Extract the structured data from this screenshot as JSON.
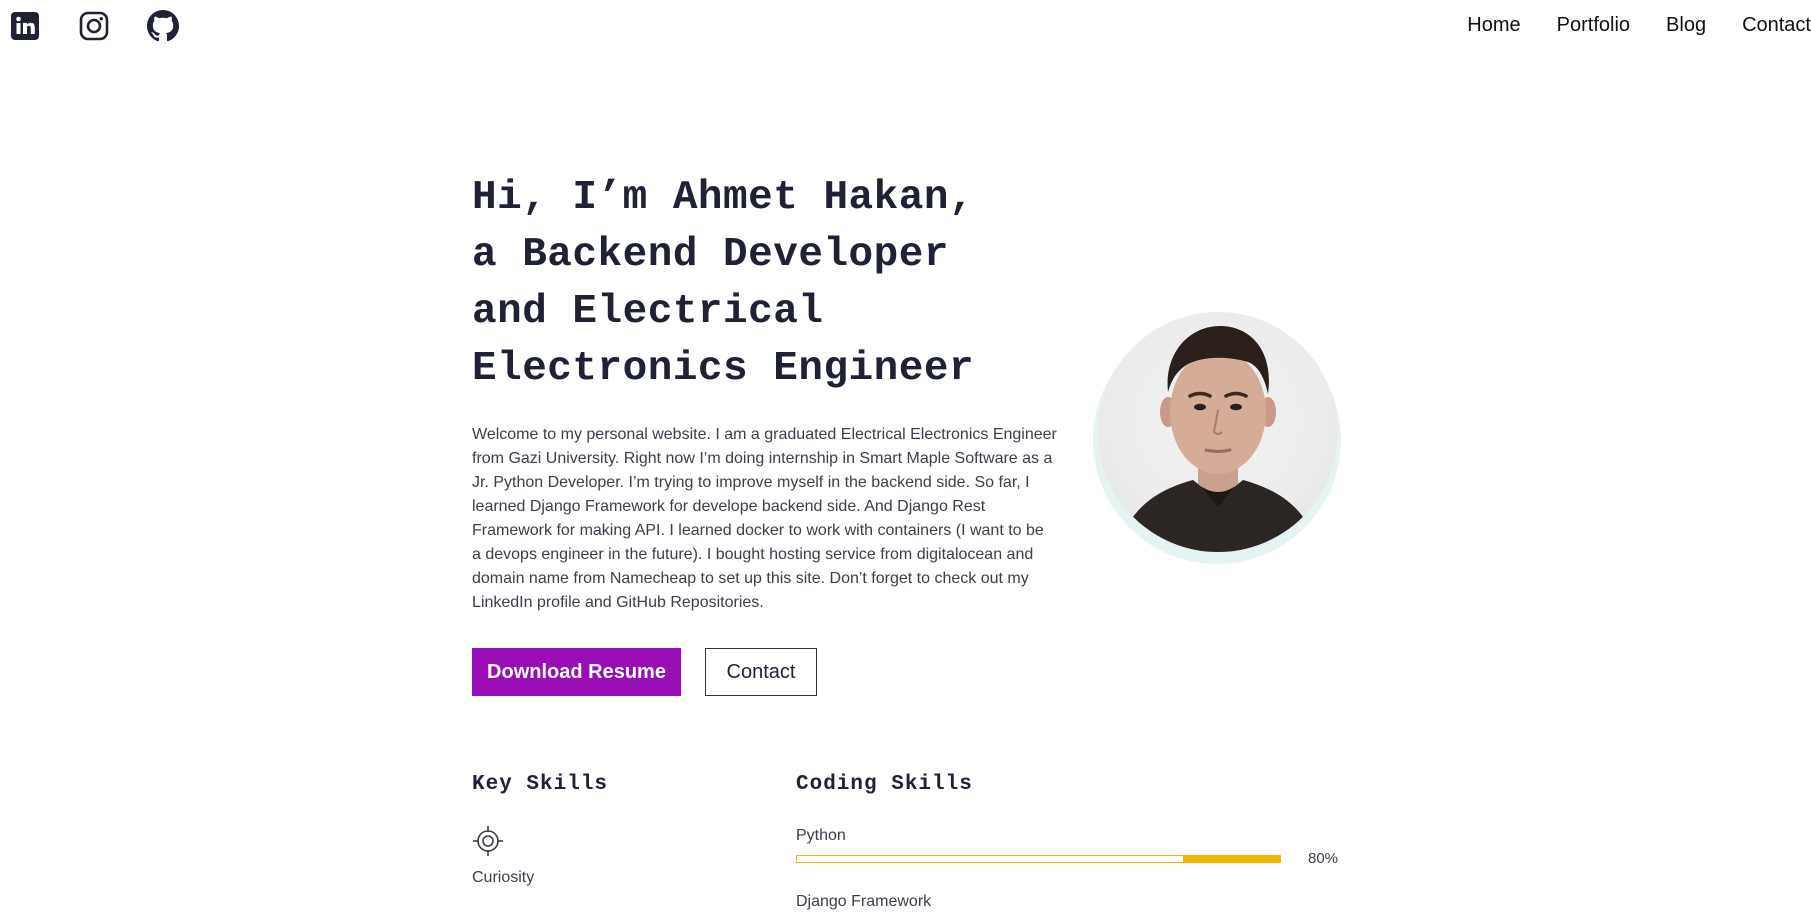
{
  "header": {
    "social": [
      {
        "name": "linkedin-icon"
      },
      {
        "name": "instagram-icon"
      },
      {
        "name": "github-icon"
      }
    ],
    "nav": [
      "Home",
      "Portfolio",
      "Blog",
      "Contact"
    ]
  },
  "hero": {
    "title_lines": [
      "Hi, I’m Ahmet Hakan,",
      "a Backend Developer",
      "and Electrical",
      "Electronics Engineer"
    ],
    "description": "Welcome to my personal website. I am a graduated Electrical Electronics Engineer from Gazi University. Right now I’m doing internship in Smart Maple Software as a Jr. Python Developer. I’m trying to improve myself in the backend side. So far, I learned Django Framework for develope backend side. And Django Rest Framework for making API. I learned docker to work with containers (I want to be a devops engineer in the future). I bought hosting service from digitalocean and domain name from Namecheap to set up this site. Don’t forget to check out my LinkedIn profile and GitHub Repositories.",
    "buttons": {
      "download": "Download Resume",
      "contact": "Contact"
    }
  },
  "skills": {
    "key_title": "Key Skills",
    "key_items": [
      {
        "label": "Curiosity",
        "icon": "target-icon"
      }
    ],
    "coding_title": "Coding Skills",
    "coding_items": [
      {
        "name": "Python",
        "percent_label": "80%",
        "percent": 80
      },
      {
        "name": "Django Framework"
      }
    ]
  },
  "colors": {
    "primary": "#9a0db6",
    "text": "#1f2235",
    "bar": "#f4b400",
    "avatar_ring": "#e6f3f3"
  }
}
